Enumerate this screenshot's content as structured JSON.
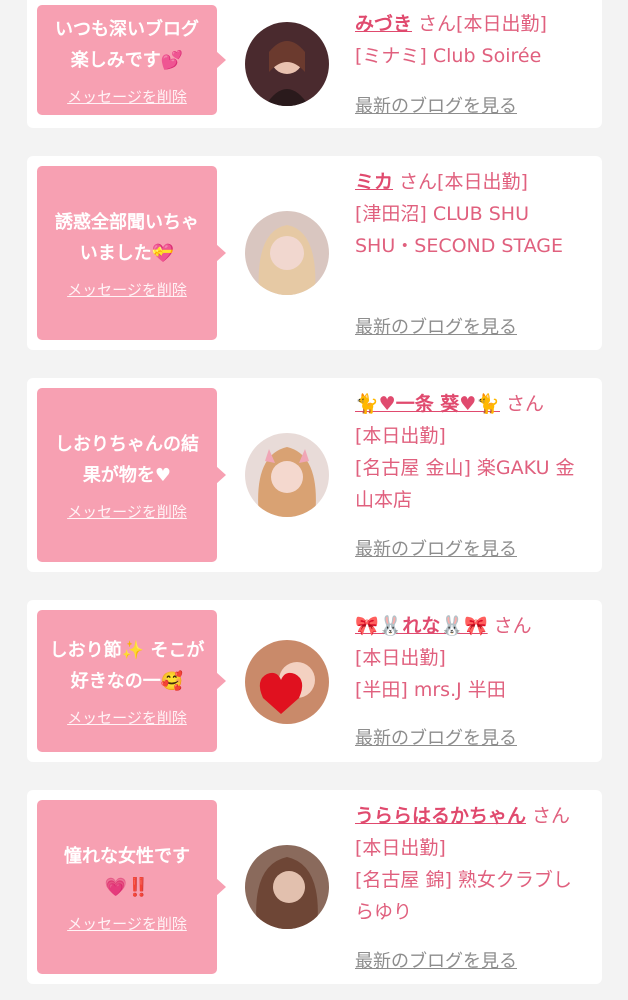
{
  "colors": {
    "background": "#f3f3f3",
    "bubble": "#f7a0b2",
    "name": "#e04a6e",
    "text": "#e0607e",
    "link": "#8d8d8d"
  },
  "cards": [
    {
      "message": "いつも深いブログ楽しみです💕",
      "delete_label": "メッセージを削除",
      "name": "みづき",
      "san": "さん",
      "status": "[本日出勤]",
      "shop": "[ミナミ] Club Soirée",
      "blog_link": "最新のブログを見る"
    },
    {
      "message": "誘惑全部聞いちゃいました💝",
      "delete_label": "メッセージを削除",
      "name": "ミカ",
      "san": "さん",
      "status": "[本日出勤]",
      "shop": "[津田沼] CLUB SHU SHU・SECOND STAGE",
      "blog_link": "最新のブログを見る"
    },
    {
      "message": "しおりちゃんの結果が物を♥",
      "delete_label": "メッセージを削除",
      "name": "🐈♥一条 葵♥🐈",
      "san": "さん",
      "status": "[本日出勤]",
      "shop": "[名古屋 金山] 楽GAKU 金山本店",
      "blog_link": "最新のブログを見る"
    },
    {
      "message": "しおり節✨ そこが好きなの一🥰",
      "delete_label": "メッセージを削除",
      "name": "🎀🐰れな🐰🎀",
      "san": "さん",
      "status": "[本日出勤]",
      "shop": "[半田] mrs.J 半田",
      "blog_link": "最新のブログを見る"
    },
    {
      "message": "憧れな女性です💗‼️",
      "delete_label": "メッセージを削除",
      "name": "うららはるかちゃん",
      "san": "さん",
      "status": "[本日出勤]",
      "shop": "[名古屋 錦] 熟女クラブしらゆり",
      "blog_link": "最新のブログを見る"
    }
  ]
}
